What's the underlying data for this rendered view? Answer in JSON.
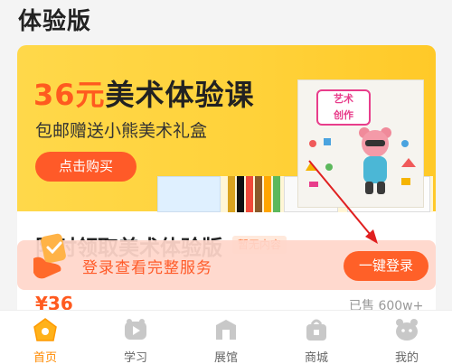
{
  "page_title": "体验版",
  "banner": {
    "title_price": "36元",
    "title_rest": "美术体验课",
    "subtitle": "包邮赠送小熊美术礼盒",
    "buy_button": "点击购买",
    "box_label_line1": "艺术",
    "box_label_line2": "创作"
  },
  "product": {
    "title": "限时领取美术体验版",
    "tag": "暂无内容",
    "price": "¥36",
    "sold": "已售 600w+"
  },
  "login_bar": {
    "text": "登录查看完整服务",
    "button": "一键登录"
  },
  "tabs": [
    {
      "label": "首页",
      "icon": "home-icon",
      "active": true
    },
    {
      "label": "学习",
      "icon": "play-icon",
      "active": false
    },
    {
      "label": "展馆",
      "icon": "gallery-icon",
      "active": false
    },
    {
      "label": "商城",
      "icon": "shop-icon",
      "active": false
    },
    {
      "label": "我的",
      "icon": "profile-bear-icon",
      "active": false
    }
  ],
  "colors": {
    "accent": "#ff5a28",
    "tab_active": "#ff8a00",
    "banner_yellow": "#ffd23a",
    "annotation_arrow": "#e02020"
  }
}
